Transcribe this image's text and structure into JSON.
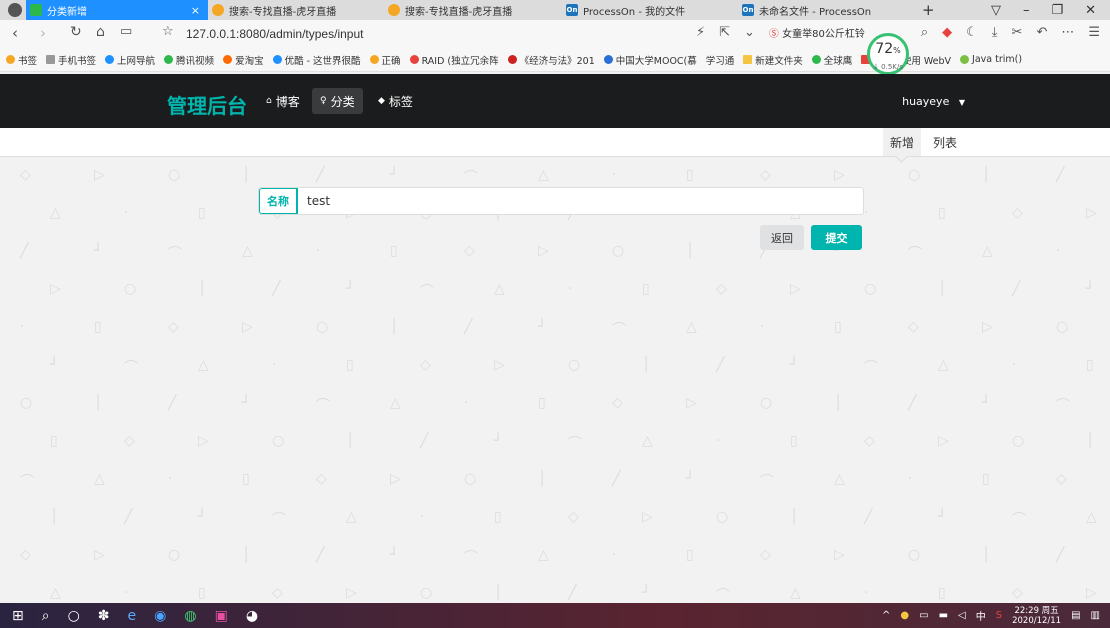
{
  "browser": {
    "tabs": [
      {
        "label": "分类新增",
        "color": "#2db84b",
        "active": true
      },
      {
        "label": "搜索-专找直播-虎牙直播",
        "color": "#f5a623",
        "active": false
      },
      {
        "label": "搜索-专找直播-虎牙直播",
        "color": "#f5a623",
        "active": false
      },
      {
        "label": "ProcessOn - 我的文件",
        "color": "#1e73be",
        "active": false
      },
      {
        "label": "未命名文件 - ProcessOn",
        "color": "#1e73be",
        "active": false
      }
    ],
    "new_tab": "+",
    "url": "127.0.0.1:8080/admin/types/input",
    "search_hint": "女童举80公斤杠铃",
    "speed_pct": "72",
    "speed_pct_unit": "%",
    "speed_rate": "↓ 0.5K/s",
    "bookmarks": [
      {
        "label": "书签",
        "color": "#f5a623"
      },
      {
        "label": "手机书签",
        "color": "#999999"
      },
      {
        "label": "上网导航",
        "color": "#1e90ff"
      },
      {
        "label": "腾讯视频",
        "color": "#2db84b"
      },
      {
        "label": "爱淘宝",
        "color": "#ff6a00"
      },
      {
        "label": "优酷 - 这世界很酷",
        "color": "#1e90ff"
      },
      {
        "label": "正确",
        "color": "#f5a623"
      },
      {
        "label": "RAID (独立冗余阵",
        "color": "#e8423f"
      },
      {
        "label": "《经济与法》201",
        "color": "#cc2222"
      },
      {
        "label": "中国大学MOOC(慕",
        "color": "#2b6fd6"
      },
      {
        "label": "学习通",
        "color": "#999999"
      },
      {
        "label": "新建文件夹",
        "color": "#f5c542"
      },
      {
        "label": "全球鹰",
        "color": "#2db84b"
      },
      {
        "label": "安卓上使用 WebV",
        "color": "#e8423f"
      },
      {
        "label": "Java trim()",
        "color": "#7ac143"
      }
    ]
  },
  "site": {
    "brand": "管理后台",
    "nav": [
      {
        "icon": "home-icon",
        "label": "博客",
        "active": false
      },
      {
        "icon": "idea-icon",
        "label": "分类",
        "active": true
      },
      {
        "icon": "tag-icon",
        "label": "标签",
        "active": false
      }
    ],
    "user": "huayeye",
    "submenu": [
      {
        "label": "新增",
        "active": true
      },
      {
        "label": "列表",
        "active": false
      }
    ]
  },
  "form": {
    "field_label": "名称",
    "field_value": "test",
    "back_label": "返回",
    "submit_label": "提交"
  },
  "taskbar": {
    "time": "22:29 周五",
    "date": "2020/12/11",
    "ime": "中"
  },
  "colors": {
    "accent": "#00b5ad",
    "navbar": "#1b1c1d"
  }
}
